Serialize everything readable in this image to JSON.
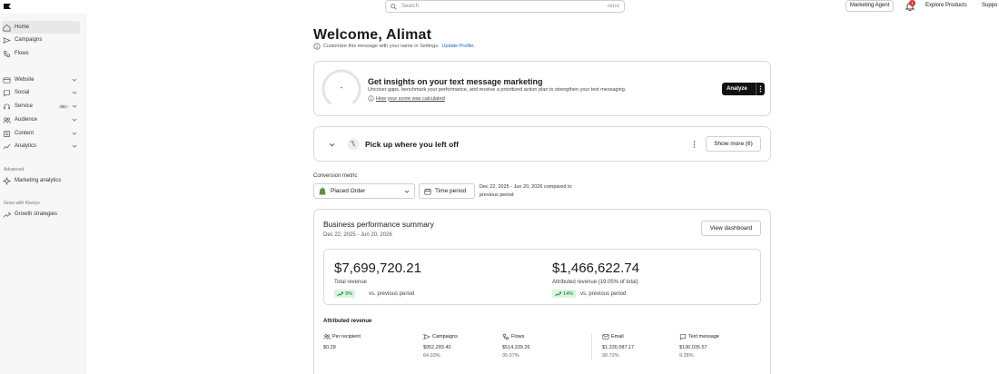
{
  "topbar": {
    "search_placeholder": "Search",
    "search_shortcut": "ctrl+k",
    "agent_label": "Marketing Agent",
    "notification_count": "1",
    "explore_label": "Explore Products",
    "support_label": "Suppo"
  },
  "sidebar": {
    "items": [
      {
        "label": "Home",
        "icon": "home-icon"
      },
      {
        "label": "Campaigns",
        "icon": "campaigns-icon"
      },
      {
        "label": "Flows",
        "icon": "flows-icon"
      },
      {
        "label": "Website",
        "icon": "website-icon"
      },
      {
        "label": "Social",
        "icon": "social-icon"
      },
      {
        "label": "Service",
        "icon": "service-icon",
        "badge": "96+"
      },
      {
        "label": "Audience",
        "icon": "audience-icon"
      },
      {
        "label": "Content",
        "icon": "content-icon"
      },
      {
        "label": "Analytics",
        "icon": "analytics-icon"
      }
    ],
    "advanced_heading": "Advanced",
    "marketing_analytics": "Marketing analytics",
    "grow_heading": "Grow with Klaviyo",
    "growth_strategies": "Growth strategies"
  },
  "main": {
    "welcome": "Welcome, Alimat",
    "customize_text": "Customize this message with your name in Settings.",
    "update_profile": "Update Profile."
  },
  "insights": {
    "score": "-",
    "title": "Get insights on your text message marketing",
    "description": "Uncover gaps, benchmark your performance, and receive a prioritized action plan to strengthen your text messaging.",
    "link": "How your score was calculated",
    "analyze": "Analyze"
  },
  "pickup": {
    "title": "Pick up where you left off",
    "show_more": "Show more (6)"
  },
  "conversion": {
    "label": "Conversion metric",
    "selected": "Placed Order",
    "time_period": "Time period",
    "range_line1": "Dec 22, 2025 - Jun 20, 2026 compared to",
    "range_line2": "previous period"
  },
  "summary": {
    "title": "Business performance summary",
    "date": "Dec 22, 2025 - Jun 20, 2026",
    "view_dashboard": "View dashboard",
    "total_revenue": "$7,699,720.21",
    "total_label": "Total revenue",
    "total_pct": "9%",
    "attr_revenue": "$1,466,622.74",
    "attr_label": "Attributed revenue (19.05% of total)",
    "attr_pct": "14%",
    "vs_prev": "vs. previous period",
    "attributed_heading": "Attributed revenue",
    "metrics": [
      {
        "label": "Per recipient",
        "value": "$0.28",
        "pct": "",
        "icon": "recipient-icon"
      },
      {
        "label": "Campaigns",
        "value": "$952,283.40",
        "pct": "64.93%",
        "icon": "campaigns-icon"
      },
      {
        "label": "Flows",
        "value": "$514,339.26",
        "pct": "35.07%",
        "icon": "flows-icon"
      },
      {
        "label": "Email",
        "value": "$1,330,587.17",
        "pct": "90.72%",
        "icon": "email-icon"
      },
      {
        "label": "Text message",
        "value": "$136,035.57",
        "pct": "9.28%",
        "icon": "sms-icon"
      }
    ]
  },
  "colors": {
    "accent_link": "#2563c9",
    "positive_bg": "#d9f5dc",
    "positive_text": "#1b6b2a",
    "dark_button": "#111111",
    "shopify_green": "#5e8e3e"
  }
}
